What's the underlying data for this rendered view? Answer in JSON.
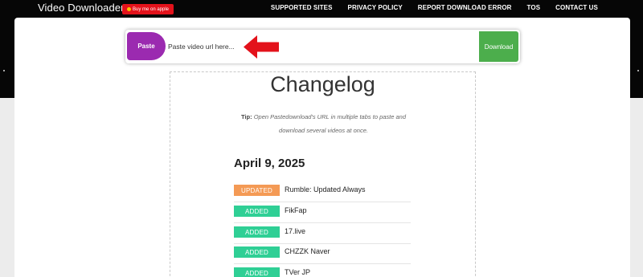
{
  "header": {
    "brand": "Video Downloader",
    "buy_label": "Buy me on apple",
    "nav": [
      "SUPPORTED SITES",
      "PRIVACY POLICY",
      "REPORT DOWNLOAD ERROR",
      "TOS",
      "CONTACT US"
    ]
  },
  "url_bar": {
    "paste_label": "Paste",
    "placeholder": "Paste video url here...",
    "download_label": "Download"
  },
  "changelog": {
    "title": "Changelog",
    "tip_label": "Tip:",
    "tip_text": "Open Pastedownload's URL in multiple tabs to paste and download several videos at once.",
    "date": "April 9, 2025",
    "entries": [
      {
        "badge": "UPDATED",
        "text": "Rumble: Updated Always"
      },
      {
        "badge": "ADDED",
        "text": "FikFap"
      },
      {
        "badge": "ADDED",
        "text": "17.live"
      },
      {
        "badge": "ADDED",
        "text": "CHZZK Naver"
      },
      {
        "badge": "ADDED",
        "text": "TVer JP"
      }
    ]
  },
  "colors": {
    "paste": "#9b2ab0",
    "download": "#4cae4c",
    "updated_badge": "#f49a55",
    "added_badge": "#2fcf95",
    "arrow": "#e3121b"
  }
}
